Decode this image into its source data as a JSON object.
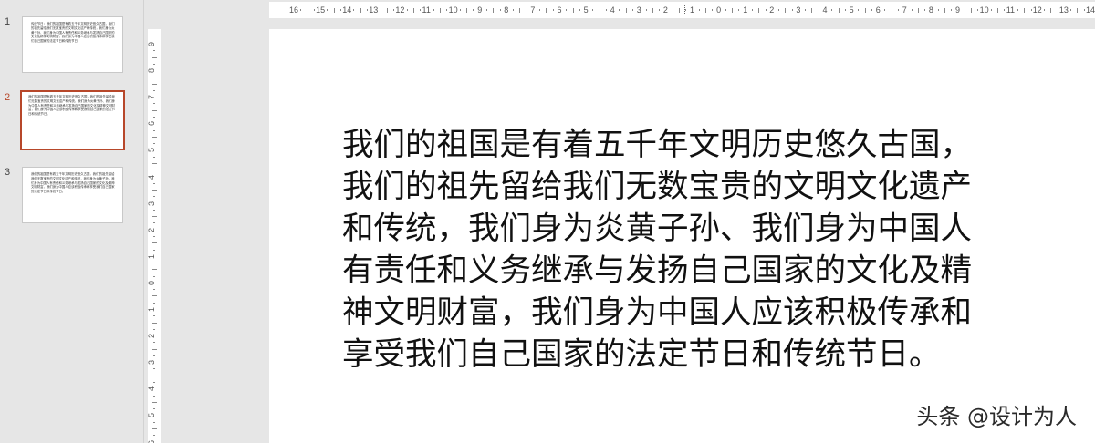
{
  "thumbnails": [
    {
      "number": "1",
      "selected": false,
      "text": "传统节日：我们的祖国是有着五千年文明历史悠久古国，我们的祖先留给我们无数宝贵的文明文化遗产和传统，我们身为炎黄子孙、我们身为中国人有责任和义务继承与发扬自己国家的文化及精神文明财富，我们身为中国人应该积极传承和享受我们自己国家的法定节日和传统节日。"
    },
    {
      "number": "2",
      "selected": true,
      "text": "我们的祖国是有着五千年文明历史悠久古国，我们的祖先留给我们无数宝贵的文明文化遗产和传统，我们身为炎黄子孙、我们身为中国人有责任和义务继承与发扬自己国家的文化及精神文明财富，我们身为中国人应该积极传承和享受我们自己国家的法定节日和传统节日。"
    },
    {
      "number": "3",
      "selected": false,
      "text": "我们的祖国是有着五千年文明历史悠久古国，我们的祖先留给我们无数宝贵的文明文化遗产和传统，我们身为炎黄子孙、我们身为中国人有责任和义务继承与发扬自己国家的文化及精神文明财富，我们身为中国人应该积极传承和享受我们自己国家的法定节日和传统节日。"
    }
  ],
  "ruler_h_labels": [
    "16",
    "15",
    "14",
    "13",
    "12",
    "11",
    "10",
    "9",
    "8",
    "7",
    "6",
    "5",
    "4",
    "3",
    "2",
    "1",
    "0",
    "1",
    "2",
    "3",
    "4",
    "5",
    "6",
    "7",
    "8",
    "9",
    "10",
    "11",
    "12",
    "13",
    "14",
    "15"
  ],
  "ruler_v_labels": [
    "9",
    "8",
    "7",
    "6",
    "5",
    "4",
    "3",
    "2",
    "1",
    "0",
    "1",
    "2",
    "3",
    "4",
    "5",
    "6"
  ],
  "slide": {
    "body_text": "我们的祖国是有着五千年文明历史悠久古国，我们的祖先留给我们无数宝贵的文明文化遗产和传统，我们身为炎黄子孙、我们身为中国人有责任和义务继承与发扬自己国家的文化及精神文明财富，我们身为中国人应该积极传承和享受我们自己国家的法定节日和传统节日。"
  },
  "watermark": "头条 @设计为人",
  "colors": {
    "selection_accent": "#b7472a",
    "workspace_bg": "#e6e6e6",
    "slide_bg": "#ffffff"
  }
}
